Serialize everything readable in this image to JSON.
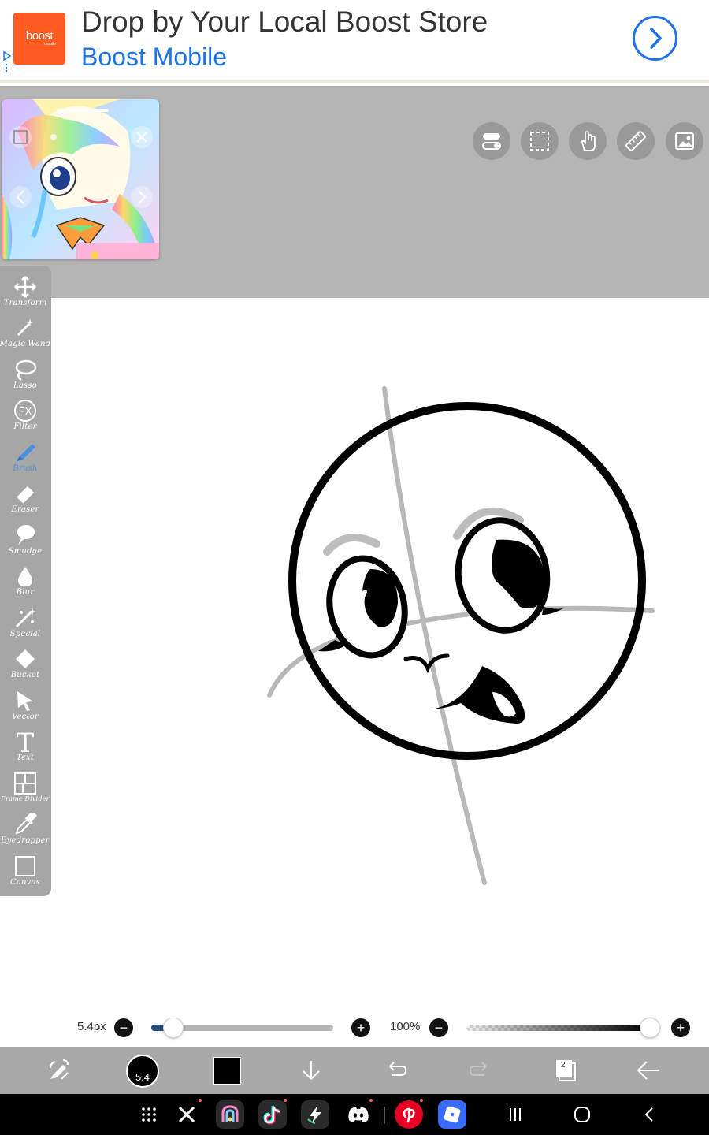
{
  "ad": {
    "title": "Drop by Your Local Boost Store",
    "advertiser": "Boost Mobile",
    "logo_text": "boost",
    "logo_subtext": "mobile",
    "logo_color": "#ff5a1f",
    "link_color": "#1a73e8",
    "arrow_icon": "chevron-right-icon"
  },
  "top_tools": [
    {
      "name": "layer-toggle-icon"
    },
    {
      "name": "selection-icon"
    },
    {
      "name": "hand-icon"
    },
    {
      "name": "ruler-icon"
    },
    {
      "name": "reference-image-icon"
    }
  ],
  "palette": {
    "items": [
      {
        "label": "Transform",
        "icon": "move-arrows-icon"
      },
      {
        "label": "Magic Wand",
        "icon": "magic-wand-icon"
      },
      {
        "label": "Lasso",
        "icon": "lasso-icon"
      },
      {
        "label": "Filter",
        "icon": "fx-icon",
        "icon_text": "FX"
      },
      {
        "label": "Brush",
        "icon": "brush-icon",
        "active": true
      },
      {
        "label": "Eraser",
        "icon": "eraser-icon"
      },
      {
        "label": "Smudge",
        "icon": "smudge-icon"
      },
      {
        "label": "Blur",
        "icon": "blur-drop-icon"
      },
      {
        "label": "Special",
        "icon": "special-sparkle-icon"
      },
      {
        "label": "Bucket",
        "icon": "bucket-icon"
      },
      {
        "label": "Vector",
        "icon": "vector-cursor-icon"
      },
      {
        "label": "Text",
        "icon": "text-icon",
        "icon_text": "T"
      },
      {
        "label": "Frame Divider",
        "icon": "frame-divider-icon"
      },
      {
        "label": "Eyedropper",
        "icon": "eyedropper-icon"
      },
      {
        "label": "Canvas",
        "icon": "canvas-icon"
      }
    ],
    "active_color": "#4a90e2"
  },
  "sliders": {
    "brush_size": {
      "value_label": "5.4px",
      "fraction": 0.12
    },
    "opacity": {
      "value_label": "100%",
      "fraction": 1.0
    }
  },
  "bottombar": {
    "brush_size_badge": "5.4",
    "current_color": "#000000",
    "layers_count": "2"
  },
  "navbar": {
    "apps": [
      "app-drawer-icon",
      "x-icon",
      "ibispaint-icon",
      "tiktok-icon",
      "power-app-icon",
      "discord-icon",
      "pinterest-icon",
      "roblox-icon"
    ]
  }
}
